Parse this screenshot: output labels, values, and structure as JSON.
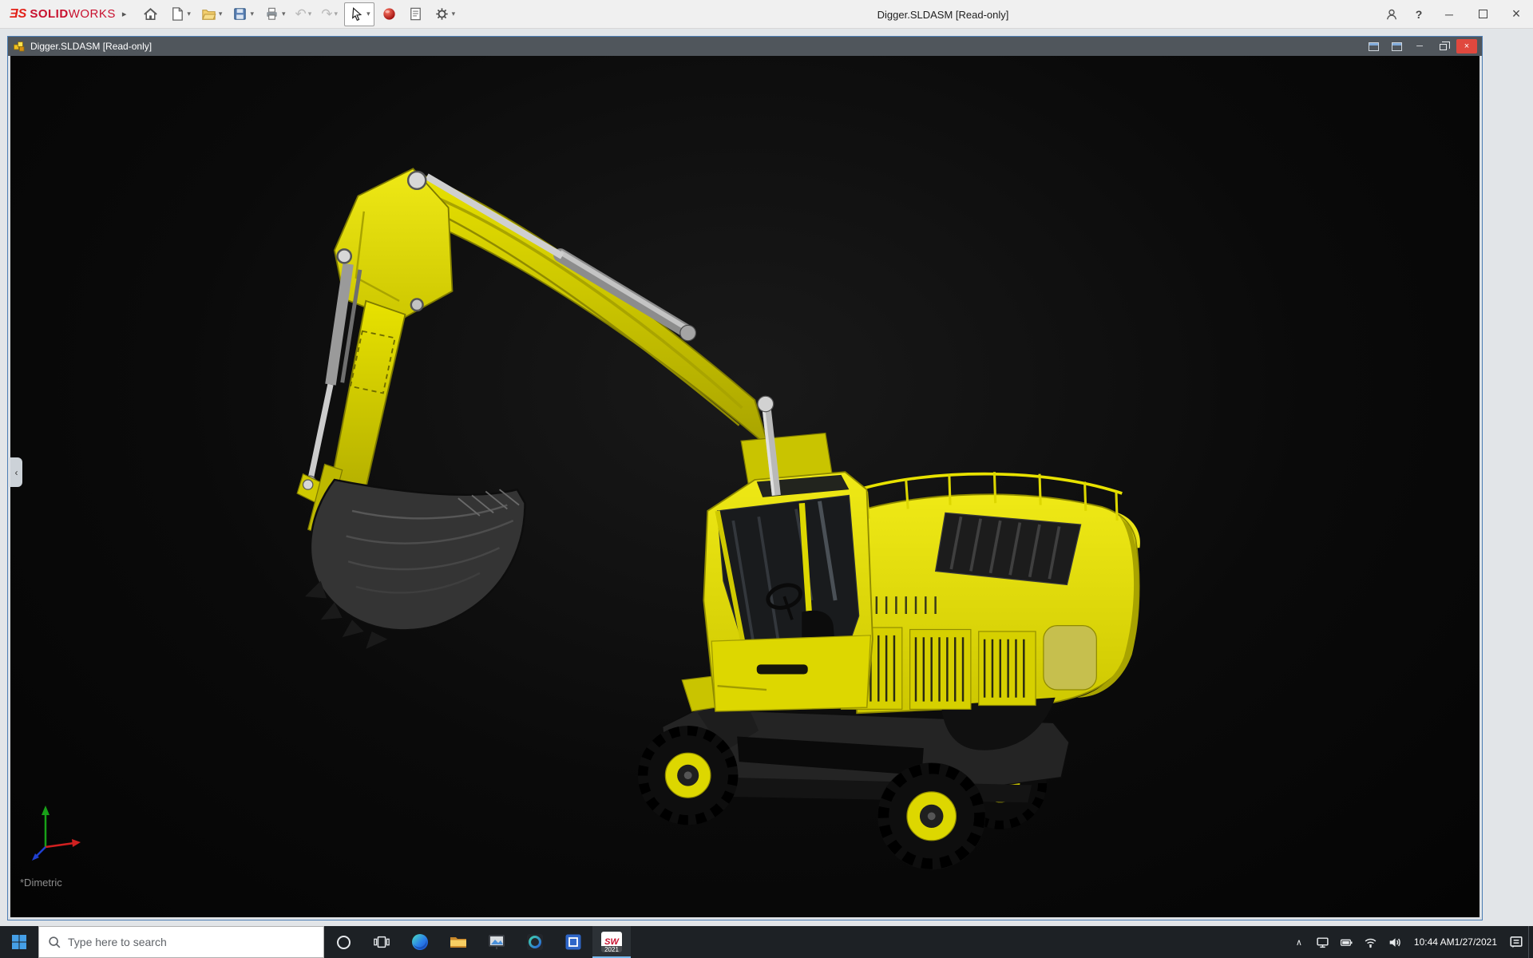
{
  "app": {
    "title": "Digger.SLDASM [Read-only]",
    "brand": {
      "mark": "ƎS",
      "bold": "SOLID",
      "light": "WORKS"
    }
  },
  "glyphs": {
    "caret_down": "▾",
    "expand_arrow": "▸",
    "minimize": "─",
    "close": "×",
    "help": "?",
    "undo": "↶",
    "redo": "↷",
    "chevron_up": "∧",
    "panel_collapse": "‹"
  },
  "document_window": {
    "title": "Digger.SLDASM [Read-only]"
  },
  "viewport": {
    "orientation": "*Dimetric"
  },
  "toolbar_icons": [
    "home",
    "new-document",
    "open-document",
    "save",
    "print",
    "undo",
    "redo",
    "select-cursor",
    "3dexperience",
    "document-properties",
    "options-gear"
  ],
  "taskbar": {
    "search_placeholder": "Type here to search",
    "sw_logo_text": "SW",
    "solidworks_badge": "2021",
    "clock": {
      "time": "10:44 AM",
      "date": "1/27/2021"
    }
  },
  "tray_icons": [
    "hidden-icons",
    "display",
    "battery",
    "network",
    "volume",
    "action-center"
  ],
  "colors": {
    "excavator_yellow": "#e3dd00",
    "close_red": "#e0483e",
    "taskbar_bg": "#1d2125",
    "child_titlebar_bg": "#50565c",
    "viewport_bg": "#0a0a0a",
    "accent_blue": "#76b9ed"
  }
}
